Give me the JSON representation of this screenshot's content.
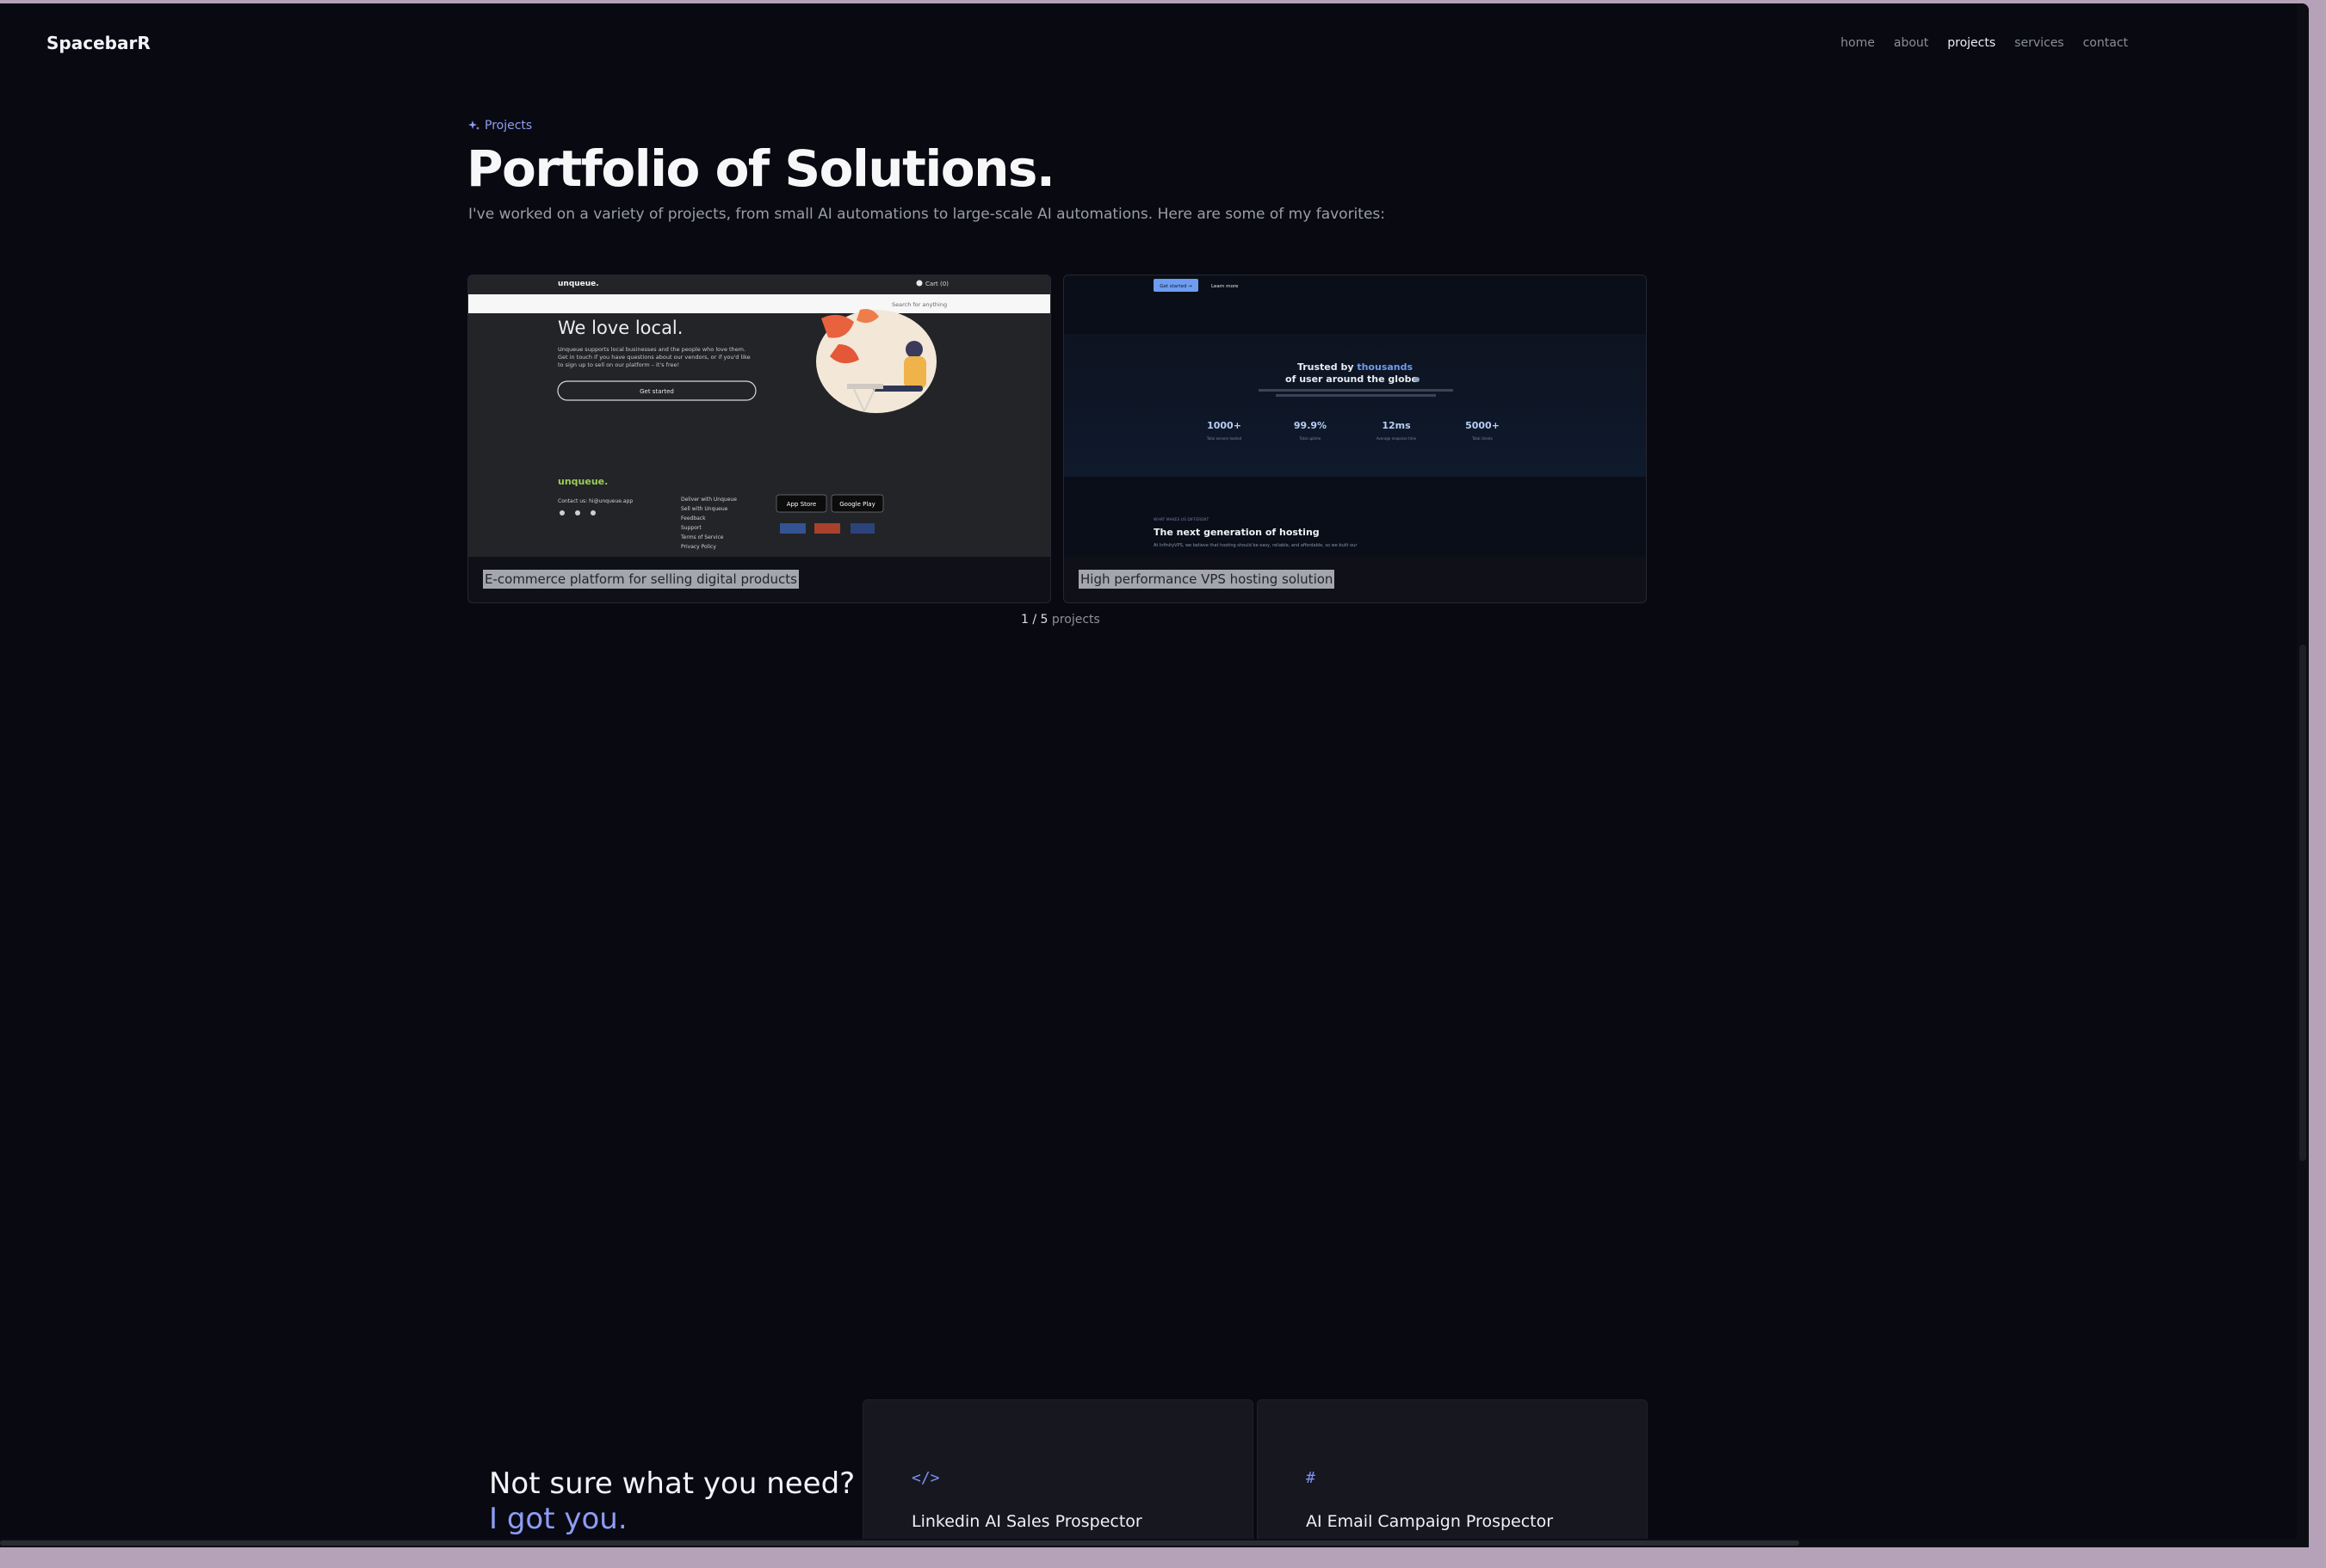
{
  "brand": "SpacebarR",
  "nav": {
    "items": [
      {
        "label": "home"
      },
      {
        "label": "about"
      },
      {
        "label": "projects"
      },
      {
        "label": "services"
      },
      {
        "label": "contact"
      }
    ],
    "active": "projects"
  },
  "hero": {
    "eyebrow": "Projects",
    "title": "Portfolio of Solutions.",
    "subtitle": "I've worked on a variety of projects, from small AI automations to large-scale AI automations. Here are some of my favorites:"
  },
  "projects": [
    {
      "caption": "E-commerce platform for selling digital products",
      "preview": {
        "logo": "unqueue.",
        "cart": "Cart (0)",
        "search": "Search for anything",
        "headline": "We love local.",
        "body1": "Unqueue supports local businesses and the people who love them.",
        "body2": "Get in touch if you have questions about our vendors, or if you'd like",
        "body3": "to sign up to sell on our platform – it's free!",
        "cta": "Get started",
        "footer_logo": "unqueue.",
        "contact": "Contact us: hi@unqueue.app",
        "links": [
          "Deliver with Unqueue",
          "Sell with Unqueue",
          "Feedback",
          "Support",
          "Terms of Service",
          "Privacy Policy"
        ],
        "app_store": "App Store",
        "google_play": "Google Play"
      }
    },
    {
      "caption": "High performance VPS hosting solution",
      "preview": {
        "btn1": "Get started →",
        "btn2": "Learn more",
        "trusted_a": "Trusted by ",
        "trusted_b": "thousands",
        "trusted_c": "of user around the globe",
        "stats": [
          {
            "value": "1000+",
            "label": "Total servers hosted"
          },
          {
            "value": "99.9%",
            "label": "Total uptime"
          },
          {
            "value": "12ms",
            "label": "Average response time"
          },
          {
            "value": "5000+",
            "label": "Total clients"
          }
        ],
        "kicker": "WHAT MAKES US DIFFERENT",
        "heading": "The next generation of hosting",
        "body": "At InfinityVPS, we believe that hosting should be easy, reliable, and affordable, so we built our"
      }
    }
  ],
  "pagination": {
    "current": "1",
    "total": "5",
    "unit": "projects"
  },
  "cta": {
    "heading": "Not sure what you need?",
    "accent": "I got you."
  },
  "services": [
    {
      "icon": "code-icon",
      "title": "Linkedin AI Sales Prospector"
    },
    {
      "icon": "hash-icon",
      "title": "AI Email Campaign Prospector"
    }
  ],
  "colors": {
    "background": "#090a11",
    "accent": "#8e9cf5",
    "card": "#16171f"
  }
}
